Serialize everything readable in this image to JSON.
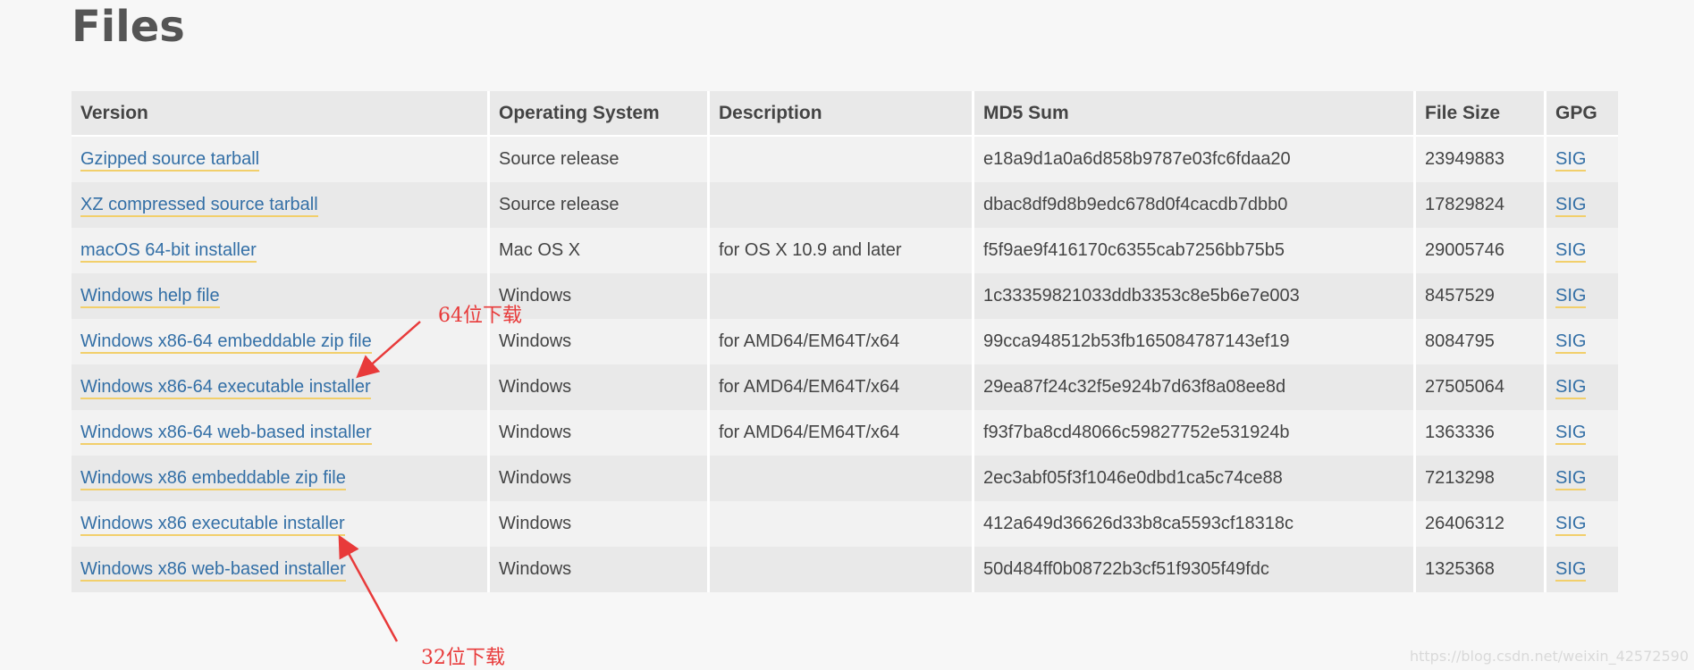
{
  "page": {
    "title": "Files"
  },
  "table": {
    "headers": {
      "version": "Version",
      "os": "Operating System",
      "description": "Description",
      "md5": "MD5 Sum",
      "size": "File Size",
      "gpg": "GPG"
    },
    "rows": [
      {
        "version": "Gzipped source tarball",
        "os": "Source release",
        "description": "",
        "md5": "e18a9d1a0a6d858b9787e03fc6fdaa20",
        "size": "23949883",
        "gpg": "SIG"
      },
      {
        "version": "XZ compressed source tarball",
        "os": "Source release",
        "description": "",
        "md5": "dbac8df9d8b9edc678d0f4cacdb7dbb0",
        "size": "17829824",
        "gpg": "SIG"
      },
      {
        "version": "macOS 64-bit installer",
        "os": "Mac OS X",
        "description": "for OS X 10.9 and later",
        "md5": "f5f9ae9f416170c6355cab7256bb75b5",
        "size": "29005746",
        "gpg": "SIG"
      },
      {
        "version": "Windows help file",
        "os": "Windows",
        "description": "",
        "md5": "1c33359821033ddb3353c8e5b6e7e003",
        "size": "8457529",
        "gpg": "SIG"
      },
      {
        "version": "Windows x86-64 embeddable zip file",
        "os": "Windows",
        "description": "for AMD64/EM64T/x64",
        "md5": "99cca948512b53fb165084787143ef19",
        "size": "8084795",
        "gpg": "SIG"
      },
      {
        "version": "Windows x86-64 executable installer",
        "os": "Windows",
        "description": "for AMD64/EM64T/x64",
        "md5": "29ea87f24c32f5e924b7d63f8a08ee8d",
        "size": "27505064",
        "gpg": "SIG"
      },
      {
        "version": "Windows x86-64 web-based installer",
        "os": "Windows",
        "description": "for AMD64/EM64T/x64",
        "md5": "f93f7ba8cd48066c59827752e531924b",
        "size": "1363336",
        "gpg": "SIG"
      },
      {
        "version": "Windows x86 embeddable zip file",
        "os": "Windows",
        "description": "",
        "md5": "2ec3abf05f3f1046e0dbd1ca5c74ce88",
        "size": "7213298",
        "gpg": "SIG"
      },
      {
        "version": "Windows x86 executable installer",
        "os": "Windows",
        "description": "",
        "md5": "412a649d36626d33b8ca5593cf18318c",
        "size": "26406312",
        "gpg": "SIG"
      },
      {
        "version": "Windows x86 web-based installer",
        "os": "Windows",
        "description": "",
        "md5": "50d484ff0b08722b3cf51f9305f49fdc",
        "size": "1325368",
        "gpg": "SIG"
      }
    ]
  },
  "annotations": {
    "label_64": "64位下载",
    "label_32": "32位下载",
    "color": "#e83a3a"
  },
  "watermark": {
    "text": "https://blog.csdn.net/weixin_42572590"
  },
  "colors": {
    "link": "#336fa6",
    "link_underline": "#f2cf6b",
    "header_bg": "#e9e9e9"
  }
}
